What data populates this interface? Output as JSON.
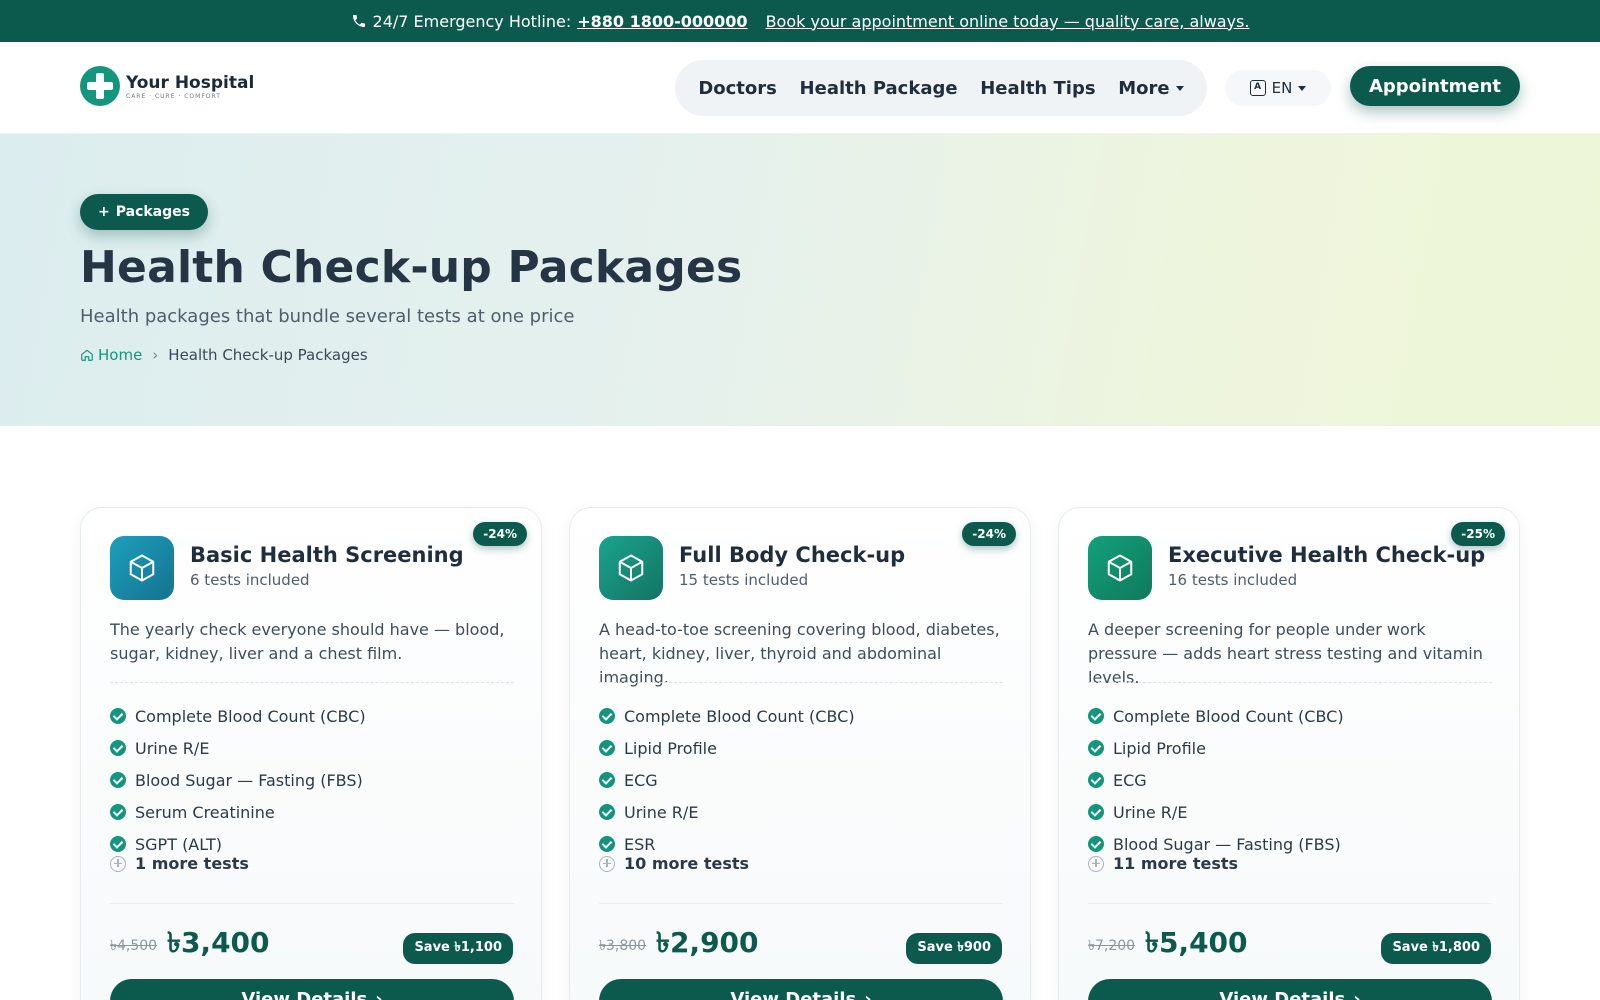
{
  "topbar": {
    "hotline_label": "24/7 Emergency Hotline:",
    "hotline_number": "+880 1800-000000",
    "promo_link": "Book your appointment online today — quality care, always."
  },
  "header": {
    "logo_name": "Your Hospital",
    "logo_tagline": "CARE · CURE · COMFORT",
    "nav": [
      {
        "label": "Doctors"
      },
      {
        "label": "Health Package"
      },
      {
        "label": "Health Tips"
      },
      {
        "label": "More"
      }
    ],
    "language": "EN",
    "appointment_button": "Appointment"
  },
  "hero": {
    "pill": "Packages",
    "title": "Health Check-up Packages",
    "subtitle": "Health packages that bundle several tests at one price",
    "breadcrumb": {
      "home": "Home",
      "current": "Health Check-up Packages"
    }
  },
  "packages": [
    {
      "discount": "-24%",
      "title": "Basic Health Screening",
      "count": "6 tests included",
      "description": "The yearly check everyone should have — blood, sugar, kidney, liver and a chest film.",
      "tests": [
        "Complete Blood Count (CBC)",
        "Urine R/E",
        "Blood Sugar — Fasting (FBS)",
        "Serum Creatinine",
        "SGPT (ALT)"
      ],
      "more": "1 more tests",
      "old_price": "৳4,500",
      "price": "৳3,400",
      "save": "Save ৳1,100",
      "button": "View Details"
    },
    {
      "discount": "-24%",
      "title": "Full Body Check-up",
      "count": "15 tests included",
      "description": "A head-to-toe screening covering blood, diabetes, heart, kidney, liver, thyroid and abdominal imaging.",
      "tests": [
        "Complete Blood Count (CBC)",
        "Lipid Profile",
        "ECG",
        "Urine R/E",
        "ESR"
      ],
      "more": "10 more tests",
      "old_price": "৳3,800",
      "price": "৳2,900",
      "save": "Save ৳900",
      "button": "View Details"
    },
    {
      "discount": "-25%",
      "title": "Executive Health Check-up",
      "count": "16 tests included",
      "description": "A deeper screening for people under work pressure — adds heart stress testing and vitamin levels.",
      "tests": [
        "Complete Blood Count (CBC)",
        "Lipid Profile",
        "ECG",
        "Urine R/E",
        "Blood Sugar — Fasting (FBS)"
      ],
      "more": "11 more tests",
      "old_price": "৳7,200",
      "price": "৳5,400",
      "save": "Save ৳1,800",
      "button": "View Details"
    }
  ],
  "colors": {
    "brand_dark": "#0c5a4e",
    "brand_accent": "#14957d"
  }
}
